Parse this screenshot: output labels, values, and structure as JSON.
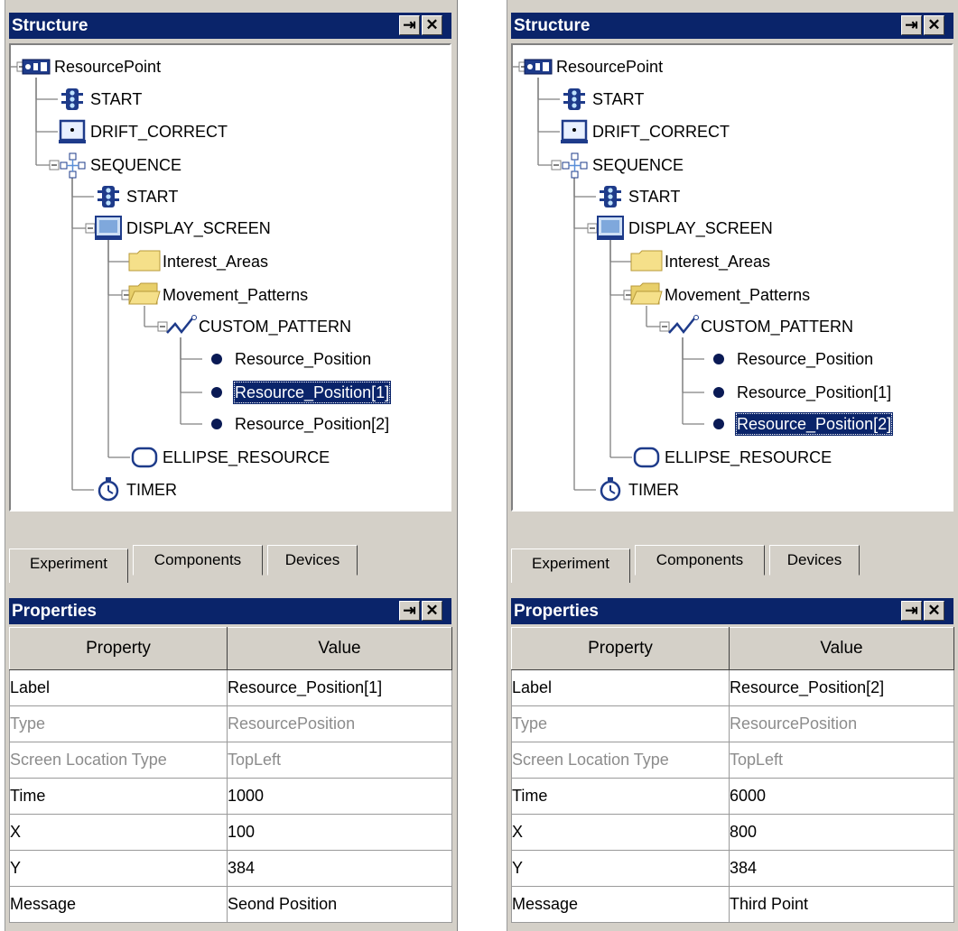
{
  "panels": [
    {
      "structure_title": "Structure",
      "properties_title": "Properties",
      "pin_icon": "pin-icon",
      "close_icon": "close-icon",
      "tree": [
        {
          "label": "ResourcePoint",
          "icon": "resourcepoint-icon",
          "selected": false
        },
        {
          "label": "START",
          "icon": "traffic-light-icon",
          "selected": false
        },
        {
          "label": "DRIFT_CORRECT",
          "icon": "drift-correct-icon",
          "selected": false
        },
        {
          "label": "SEQUENCE",
          "icon": "sequence-icon",
          "selected": false
        },
        {
          "label": "START",
          "icon": "traffic-light-icon",
          "selected": false
        },
        {
          "label": "DISPLAY_SCREEN",
          "icon": "monitor-icon",
          "selected": false
        },
        {
          "label": "Interest_Areas",
          "icon": "folder-icon",
          "selected": false
        },
        {
          "label": "Movement_Patterns",
          "icon": "folder-open-icon",
          "selected": false
        },
        {
          "label": "CUSTOM_PATTERN",
          "icon": "pattern-icon",
          "selected": false
        },
        {
          "label": "Resource_Position",
          "icon": "dot-icon",
          "selected": false
        },
        {
          "label": "Resource_Position[1]",
          "icon": "dot-icon",
          "selected": true
        },
        {
          "label": "Resource_Position[2]",
          "icon": "dot-icon",
          "selected": false
        },
        {
          "label": "ELLIPSE_RESOURCE",
          "icon": "ellipse-icon",
          "selected": false
        },
        {
          "label": "TIMER",
          "icon": "timer-icon",
          "selected": false
        }
      ],
      "tabs": [
        {
          "label": "Experiment",
          "active": true
        },
        {
          "label": "Components",
          "active": false
        },
        {
          "label": "Devices",
          "active": false
        }
      ],
      "table_headers": [
        "Property",
        "Value"
      ],
      "properties": [
        {
          "name": "Label",
          "value": "Resource_Position[1]",
          "dim": false
        },
        {
          "name": "Type",
          "value": "ResourcePosition",
          "dim": true
        },
        {
          "name": "Screen Location Type",
          "value": "TopLeft",
          "dim": true
        },
        {
          "name": "Time",
          "value": "1000",
          "dim": false
        },
        {
          "name": "X",
          "value": "100",
          "dim": false
        },
        {
          "name": "Y",
          "value": "384",
          "dim": false
        },
        {
          "name": "Message",
          "value": "Seond Position",
          "dim": false
        }
      ]
    },
    {
      "structure_title": "Structure",
      "properties_title": "Properties",
      "pin_icon": "pin-icon",
      "close_icon": "close-icon",
      "tree": [
        {
          "label": "ResourcePoint",
          "icon": "resourcepoint-icon",
          "selected": false
        },
        {
          "label": "START",
          "icon": "traffic-light-icon",
          "selected": false
        },
        {
          "label": "DRIFT_CORRECT",
          "icon": "drift-correct-icon",
          "selected": false
        },
        {
          "label": "SEQUENCE",
          "icon": "sequence-icon",
          "selected": false
        },
        {
          "label": "START",
          "icon": "traffic-light-icon",
          "selected": false
        },
        {
          "label": "DISPLAY_SCREEN",
          "icon": "monitor-icon",
          "selected": false
        },
        {
          "label": "Interest_Areas",
          "icon": "folder-icon",
          "selected": false
        },
        {
          "label": "Movement_Patterns",
          "icon": "folder-open-icon",
          "selected": false
        },
        {
          "label": "CUSTOM_PATTERN",
          "icon": "pattern-icon",
          "selected": false
        },
        {
          "label": "Resource_Position",
          "icon": "dot-icon",
          "selected": false
        },
        {
          "label": "Resource_Position[1]",
          "icon": "dot-icon",
          "selected": false
        },
        {
          "label": "Resource_Position[2]",
          "icon": "dot-icon",
          "selected": true
        },
        {
          "label": "ELLIPSE_RESOURCE",
          "icon": "ellipse-icon",
          "selected": false
        },
        {
          "label": "TIMER",
          "icon": "timer-icon",
          "selected": false
        }
      ],
      "tabs": [
        {
          "label": "Experiment",
          "active": true
        },
        {
          "label": "Components",
          "active": false
        },
        {
          "label": "Devices",
          "active": false
        }
      ],
      "table_headers": [
        "Property",
        "Value"
      ],
      "properties": [
        {
          "name": "Label",
          "value": "Resource_Position[2]",
          "dim": false
        },
        {
          "name": "Type",
          "value": "ResourcePosition",
          "dim": true
        },
        {
          "name": "Screen Location Type",
          "value": "TopLeft",
          "dim": true
        },
        {
          "name": "Time",
          "value": "6000",
          "dim": false
        },
        {
          "name": "X",
          "value": "800",
          "dim": false
        },
        {
          "name": "Y",
          "value": "384",
          "dim": false
        },
        {
          "name": "Message",
          "value": "Third Point",
          "dim": false
        }
      ]
    }
  ]
}
